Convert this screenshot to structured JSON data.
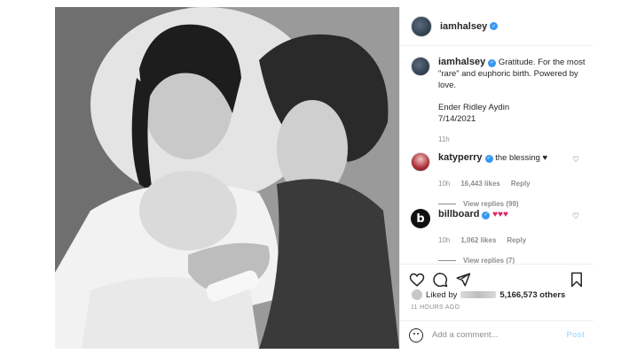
{
  "post": {
    "author": "iamhalsey",
    "caption_text": "Gratitude. For the most \"rare\" and euphoric birth. Powered by love.",
    "caption_line2": "Ender Ridley Aydin",
    "caption_line3": "7/14/2021",
    "caption_age": "11h",
    "photo_description_icon": "next-arrow-icon"
  },
  "comments": [
    {
      "user": "katyperry",
      "text": "the blessing ♥",
      "age": "10h",
      "likes": "16,443 likes",
      "reply_label": "Reply",
      "view_replies": "View replies (99)"
    },
    {
      "user": "billboard",
      "text": "♥♥♥",
      "age": "10h",
      "likes": "1,062 likes",
      "reply_label": "Reply",
      "view_replies": "View replies (7)"
    }
  ],
  "likes_summary": {
    "prefix": "Liked by",
    "suffix": "5,166,573 others"
  },
  "post_time": "11 HOURS AGO",
  "add_comment": {
    "placeholder": "Add a comment...",
    "post_label": "Post"
  },
  "colors": {
    "verified": "#3897f0",
    "hearts": "#e0245e",
    "post_button": "#b2dffc",
    "meta_text": "#8e8e8e"
  }
}
